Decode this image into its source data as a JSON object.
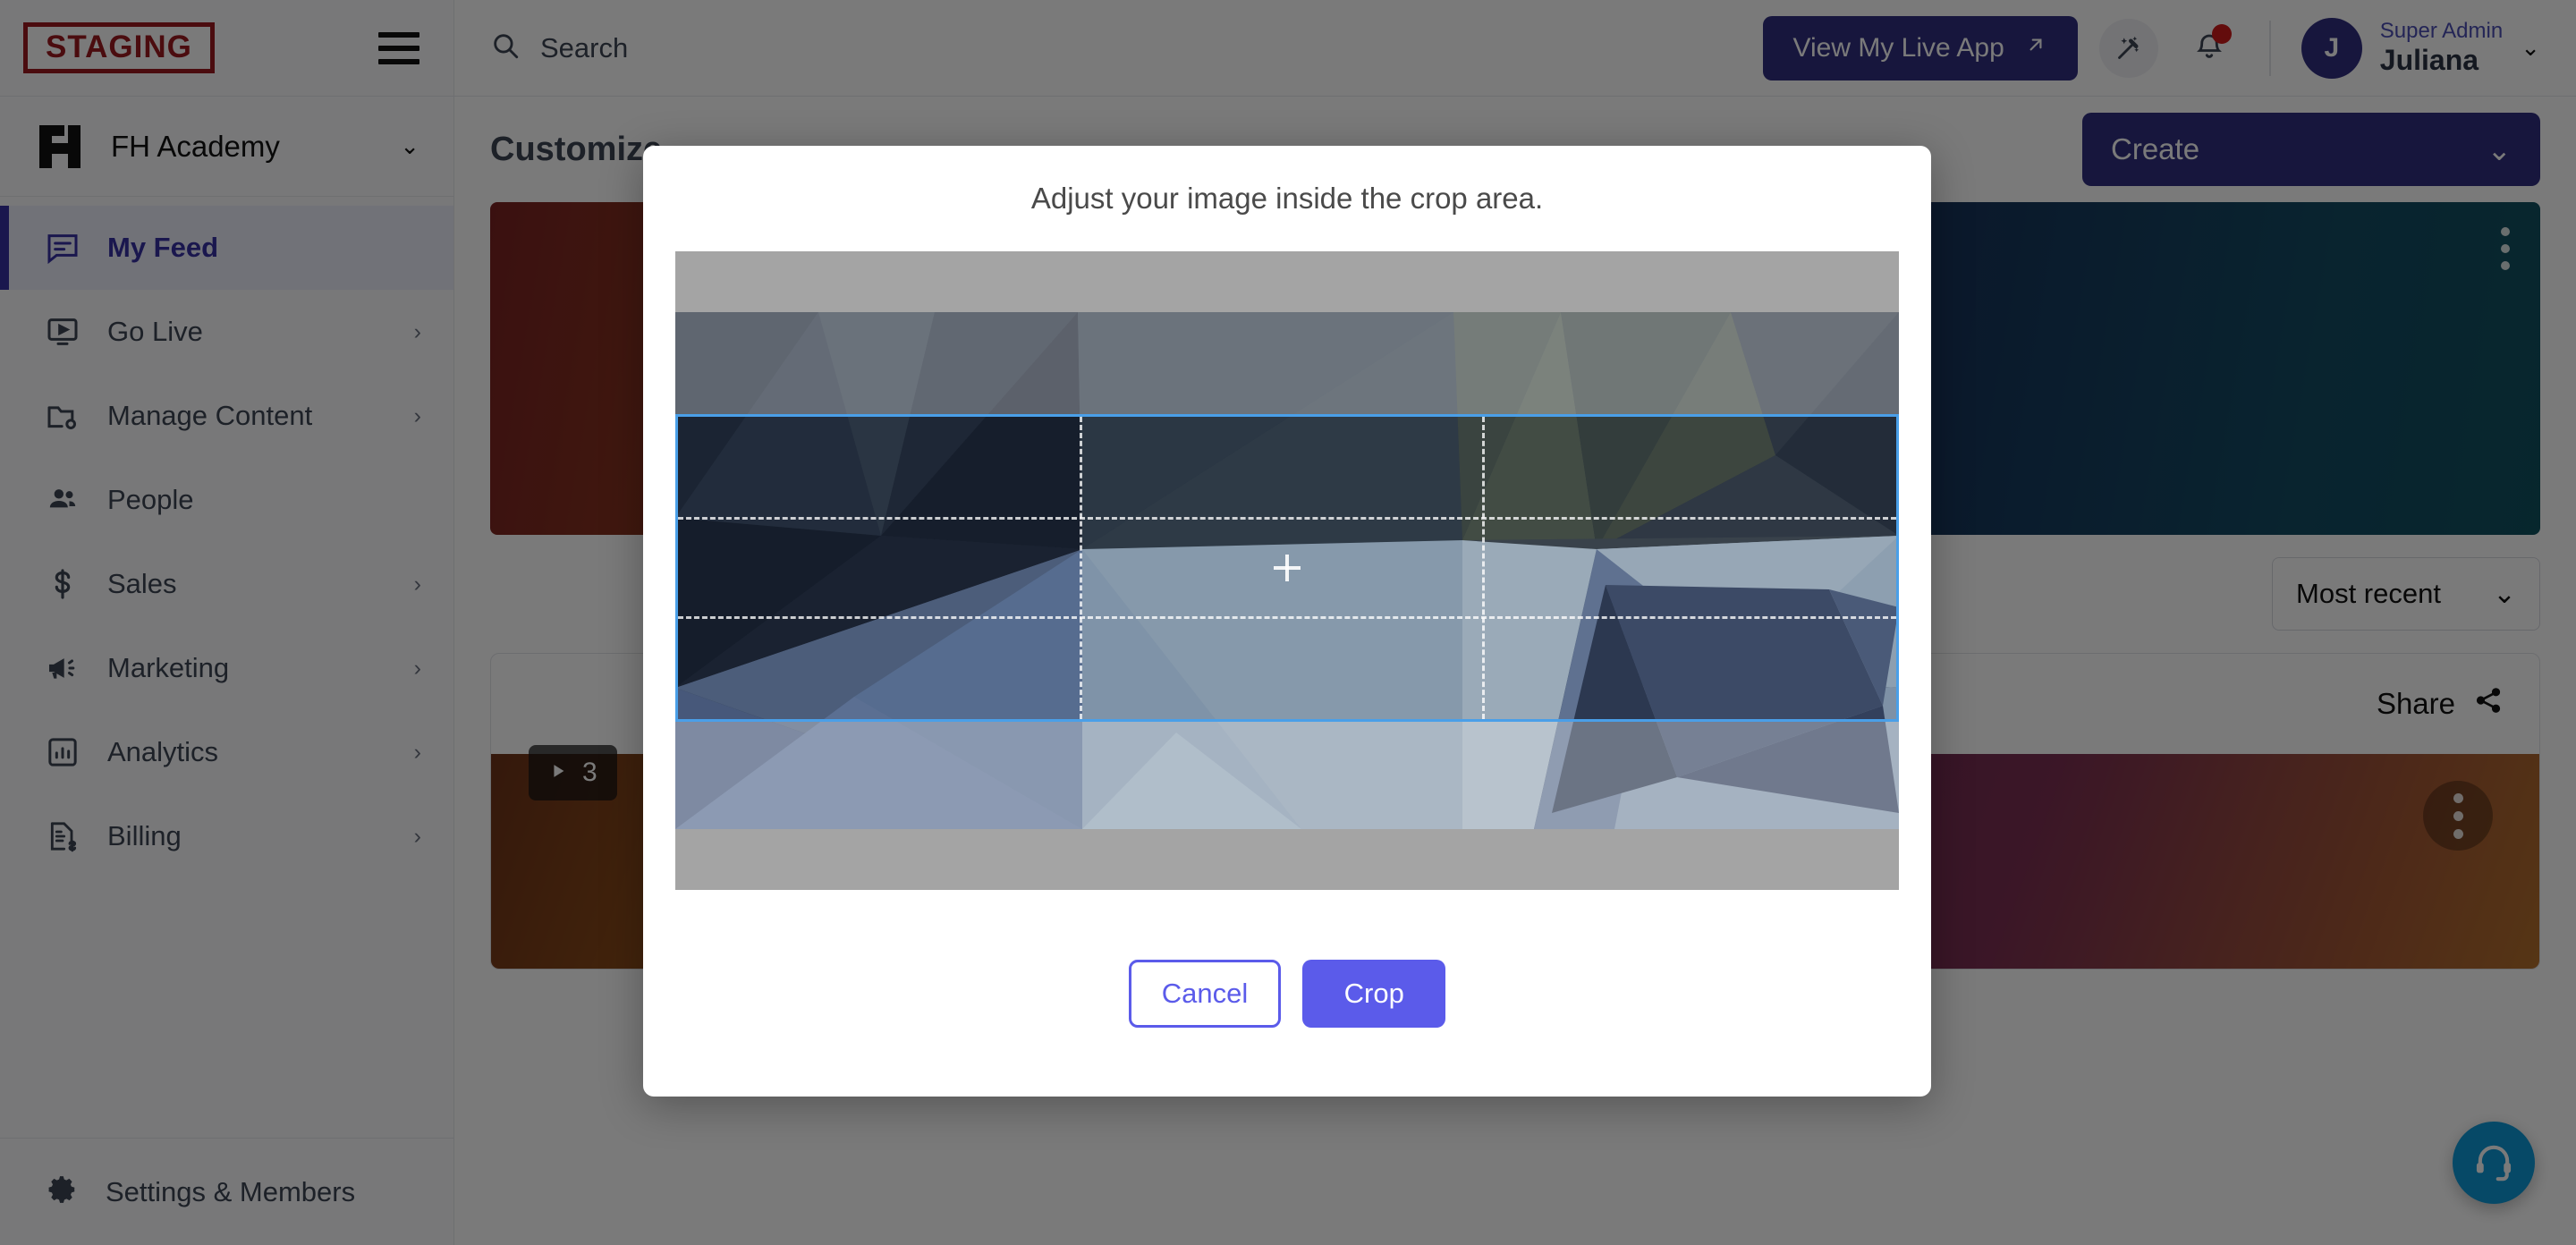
{
  "sidebar": {
    "staging_badge": "STAGING",
    "hamburger_icon": "hamburger-menu-icon",
    "org": {
      "name": "FH Academy",
      "logo_icon": "fh-logo-icon",
      "chevron": "⌄"
    },
    "items": [
      {
        "label": "My Feed",
        "icon": "feed-icon",
        "active": true,
        "arrow": ""
      },
      {
        "label": "Go Live",
        "icon": "broadcast-icon",
        "active": false,
        "arrow": "›"
      },
      {
        "label": "Manage Content",
        "icon": "folder-gear-icon",
        "active": false,
        "arrow": "›"
      },
      {
        "label": "People",
        "icon": "people-icon",
        "active": false,
        "arrow": ""
      },
      {
        "label": "Sales",
        "icon": "dollar-icon",
        "active": false,
        "arrow": "›"
      },
      {
        "label": "Marketing",
        "icon": "megaphone-icon",
        "active": false,
        "arrow": "›"
      },
      {
        "label": "Analytics",
        "icon": "chart-icon",
        "active": false,
        "arrow": "›"
      },
      {
        "label": "Billing",
        "icon": "invoice-icon",
        "active": false,
        "arrow": "›"
      }
    ],
    "settings": {
      "label": "Settings & Members",
      "icon": "gear-icon"
    }
  },
  "topbar": {
    "search_placeholder": "Search",
    "search_value": "",
    "search_icon": "search-icon",
    "live_app_label": "View My Live App",
    "live_app_icon": "external-link-icon",
    "wand_icon": "magic-wand-icon",
    "bell_icon": "bell-icon",
    "has_notification": true,
    "user": {
      "role": "Super Admin",
      "name": "Juliana",
      "initial": "J",
      "chevron": "⌄"
    }
  },
  "content": {
    "page_title": "Customize",
    "create_label": "Create",
    "create_chevron": "⌄",
    "sort_label": "Most recent",
    "sort_chevron": "⌄",
    "share_label": "Share",
    "share_icon": "share-icon",
    "play_badge": "3",
    "play_icon": "play-icon",
    "kebab_icon": "more-options-icon"
  },
  "modal": {
    "title": "Adjust your image inside the crop area.",
    "cancel_label": "Cancel",
    "crop_label": "Crop",
    "crosshair_icon": "crosshair-icon"
  },
  "support": {
    "icon": "headset-support-icon"
  },
  "colors": {
    "accent": "#5b5bea",
    "brand_dark": "#312e81",
    "staging_red": "#9e1b20",
    "crop_border": "#4a9fe8",
    "support_blue": "#0d98d8",
    "notification_red": "#d01b1b"
  }
}
